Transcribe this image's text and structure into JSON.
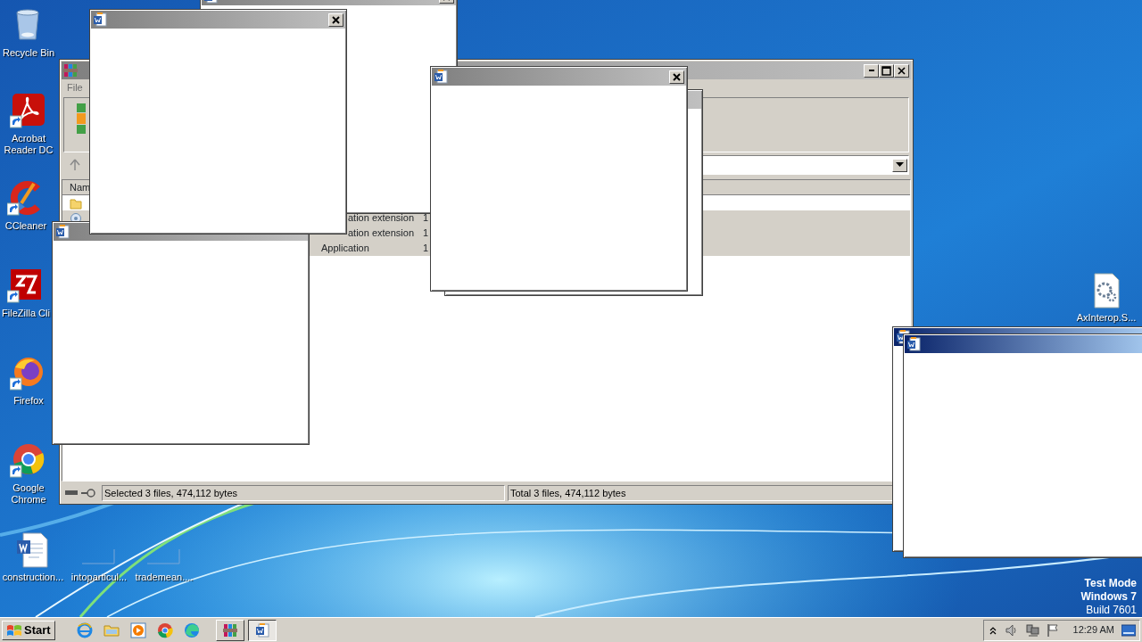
{
  "desktop_icons": [
    {
      "label": "Recycle Bin",
      "kind": "recycle_bin",
      "shortcut": false
    },
    {
      "label": "Acrobat Reader DC",
      "kind": "pdf",
      "shortcut": true
    },
    {
      "label": "CCleaner",
      "kind": "ccleaner",
      "shortcut": true
    },
    {
      "label": "FileZilla Cli",
      "kind": "filezilla",
      "shortcut": true
    },
    {
      "label": "Firefox",
      "kind": "firefox",
      "shortcut": true
    },
    {
      "label": "Google Chrome",
      "kind": "chrome",
      "shortcut": true
    },
    {
      "label": "construction...",
      "kind": "word_doc",
      "shortcut": false
    },
    {
      "label": "intoparticul...",
      "kind": "blank",
      "shortcut": false
    },
    {
      "label": "trademean....",
      "kind": "blank",
      "shortcut": false
    },
    {
      "label": "AxInterop.S...",
      "kind": "config",
      "shortcut": false
    }
  ],
  "archive_window": {
    "menu": [
      "File"
    ],
    "list_header": "Nam",
    "rows": [
      {
        "kind": "parent",
        "type": "",
        "size": "",
        "selected": false
      },
      {
        "kind": "file",
        "type": "ation extension",
        "size": "1",
        "selected": true
      },
      {
        "type": "ation extension",
        "size": "1",
        "selected": true
      },
      {
        "type": "Application",
        "size": "1",
        "selected": true
      }
    ],
    "status_left": "Selected 3 files, 474,112 bytes",
    "status_right": "Total 3 files, 474,112 bytes"
  },
  "dialogs": [
    {
      "active": false,
      "close_button": true
    },
    {
      "active": false,
      "close_button": true
    },
    {
      "active": false,
      "close_button": false
    },
    {
      "active": false,
      "close_button": false
    },
    {
      "active": false,
      "close_button": true
    },
    {
      "active": true,
      "close_button": false
    },
    {
      "active": true,
      "close_button": false
    }
  ],
  "taskbar": {
    "start_label": "Start",
    "quick_launch": [
      {
        "kind": "ie"
      },
      {
        "kind": "explorer"
      },
      {
        "kind": "media"
      },
      {
        "kind": "chrome"
      },
      {
        "kind": "edge"
      }
    ],
    "tasks": [
      {
        "kind": "winrar",
        "selected": false
      },
      {
        "kind": "word",
        "selected": true
      }
    ],
    "clock": "12:29 AM"
  },
  "os_notice": [
    "Test Mode",
    "Windows 7",
    "Build 7601"
  ]
}
